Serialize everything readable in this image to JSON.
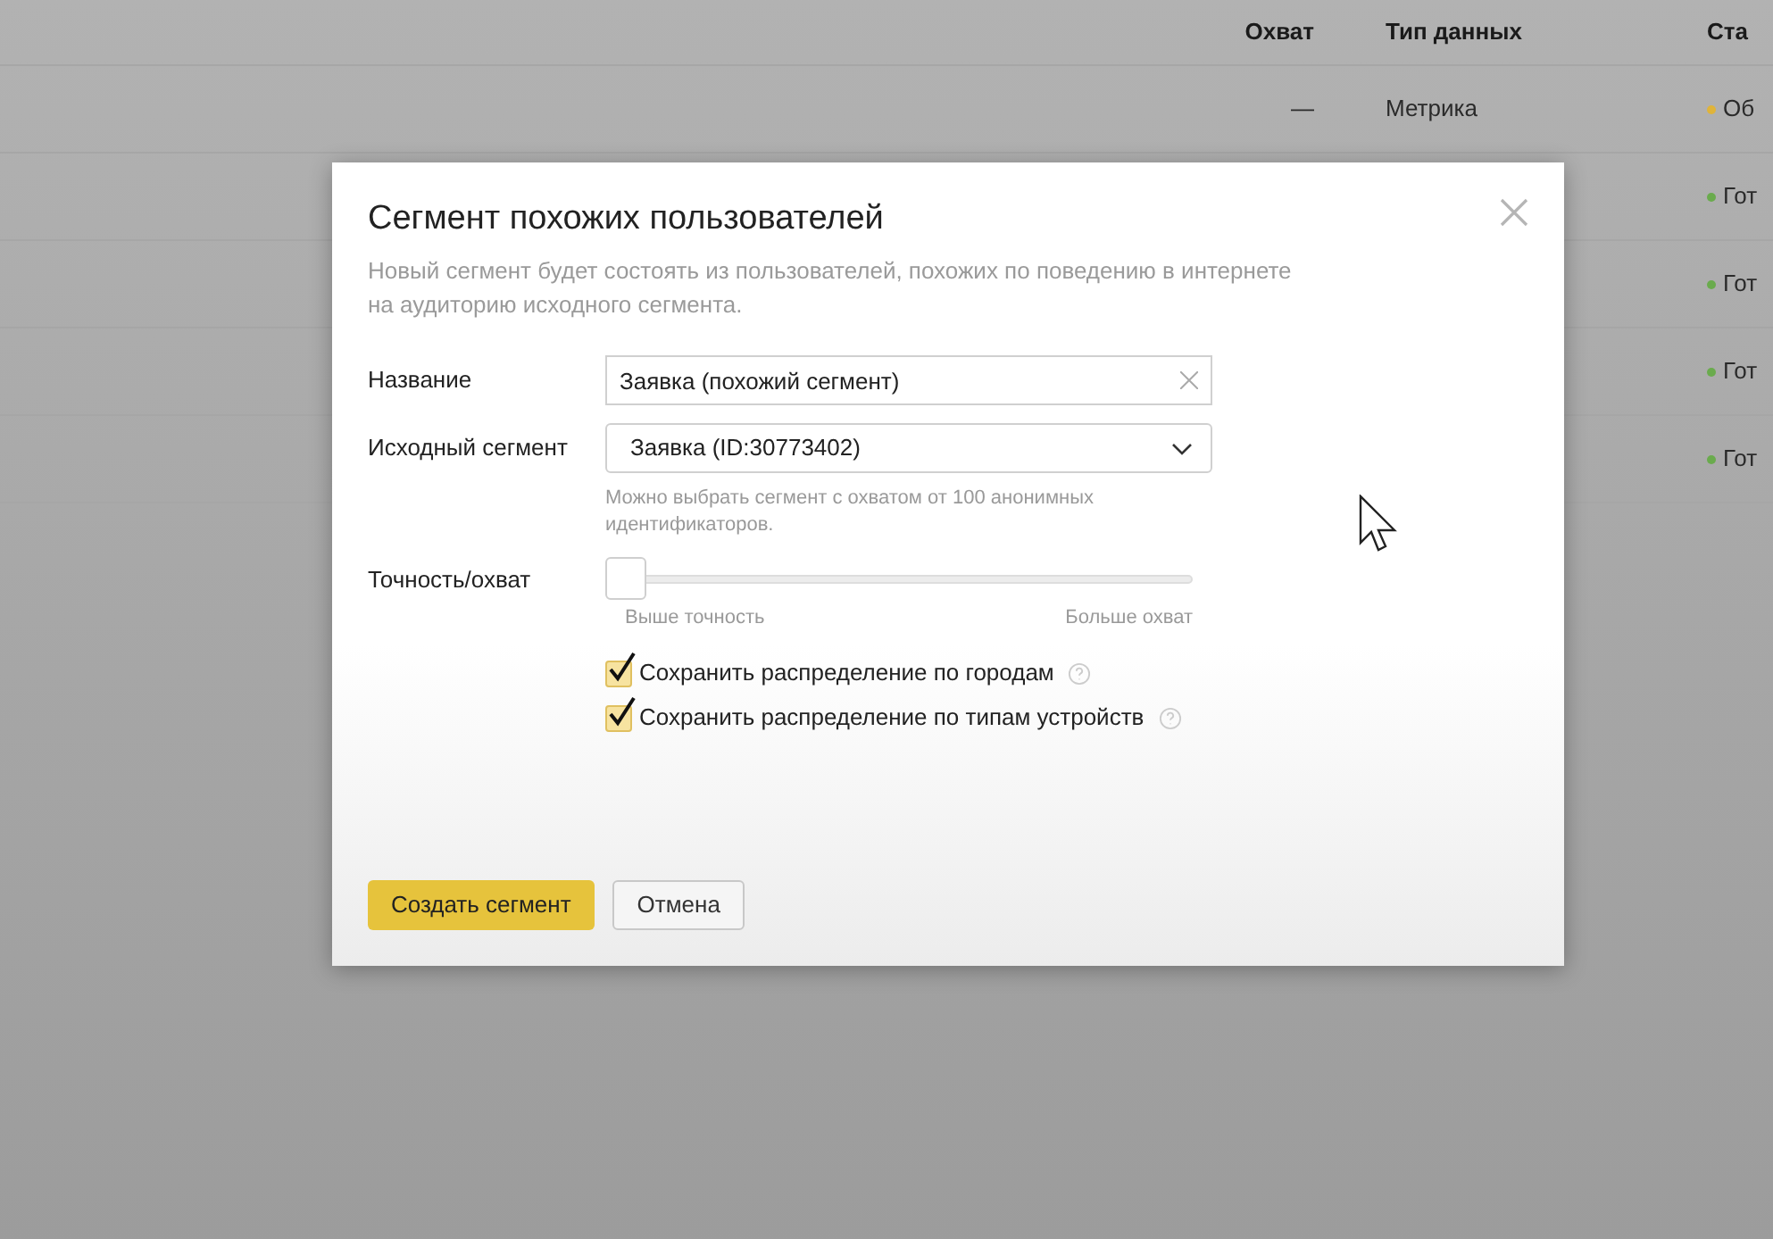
{
  "table": {
    "columns": [
      "Охват",
      "Тип данных",
      "Ста"
    ],
    "rows": [
      {
        "reach": "—",
        "data_type": "Метрика",
        "status": "Об",
        "color": "#e0b43a"
      },
      {
        "status": "Гот",
        "color": "#6aab4d"
      },
      {
        "status": "Гот",
        "color": "#6aab4d"
      },
      {
        "status": "Гот",
        "color": "#6aab4d"
      },
      {
        "status": "Гот",
        "color": "#6aab4d"
      }
    ]
  },
  "dialog": {
    "title": "Сегмент похожих пользователей",
    "description": "Новый сегмент будет состоять из пользователей, похожих по поведению в интернете на аудиторию исходного сегмента.",
    "name_label": "Название",
    "name_value": "Заявка (похожий сегмент)",
    "source_label": "Исходный сегмент",
    "source_value": "Заявка (ID:30773402)",
    "source_hint": "Можно выбрать сегмент с охватом от 100 анонимных идентификаторов.",
    "slider": {
      "label": "Точность/охват",
      "level": 0,
      "min_label": "Выше точность",
      "max_label": "Больше охват"
    },
    "checkboxes": [
      {
        "label": "Сохранить распределение по городам",
        "checked": true
      },
      {
        "label": "Сохранить распределение по типам устройств",
        "checked": true
      }
    ],
    "buttons": [
      {
        "label": "Создать сегмент",
        "kind": "primary"
      },
      {
        "label": "Отмена",
        "kind": "secondary"
      }
    ]
  }
}
